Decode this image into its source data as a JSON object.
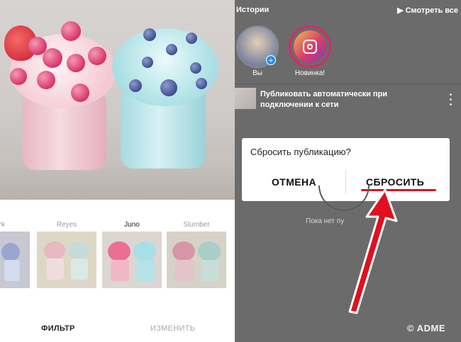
{
  "left": {
    "filters": [
      {
        "label": "ark",
        "active": false
      },
      {
        "label": "Reyes",
        "active": false
      },
      {
        "label": "Juno",
        "active": true
      },
      {
        "label": "Slumber",
        "active": false
      }
    ],
    "tabs": {
      "filter": "ФИЛЬТР",
      "edit": "ИЗМЕНИТЬ"
    }
  },
  "right": {
    "stories_title": "Истории",
    "watch_all": "▶ Смотреть все",
    "stories": [
      {
        "label": "Вы"
      },
      {
        "label": "Новинка!"
      }
    ],
    "auto_publish": "Публиковать автоматически при подключении к сети",
    "dialog": {
      "title": "Сбросить публикацию?",
      "cancel": "ОТМЕНА",
      "reset": "СБРОСИТЬ"
    },
    "empty_text": "Пока нет пу",
    "watermark": "© ADME"
  },
  "colors": {
    "accent_red": "#e0101e",
    "instagram_ring": "#d6296a",
    "overlay": "#6b6b6b"
  }
}
